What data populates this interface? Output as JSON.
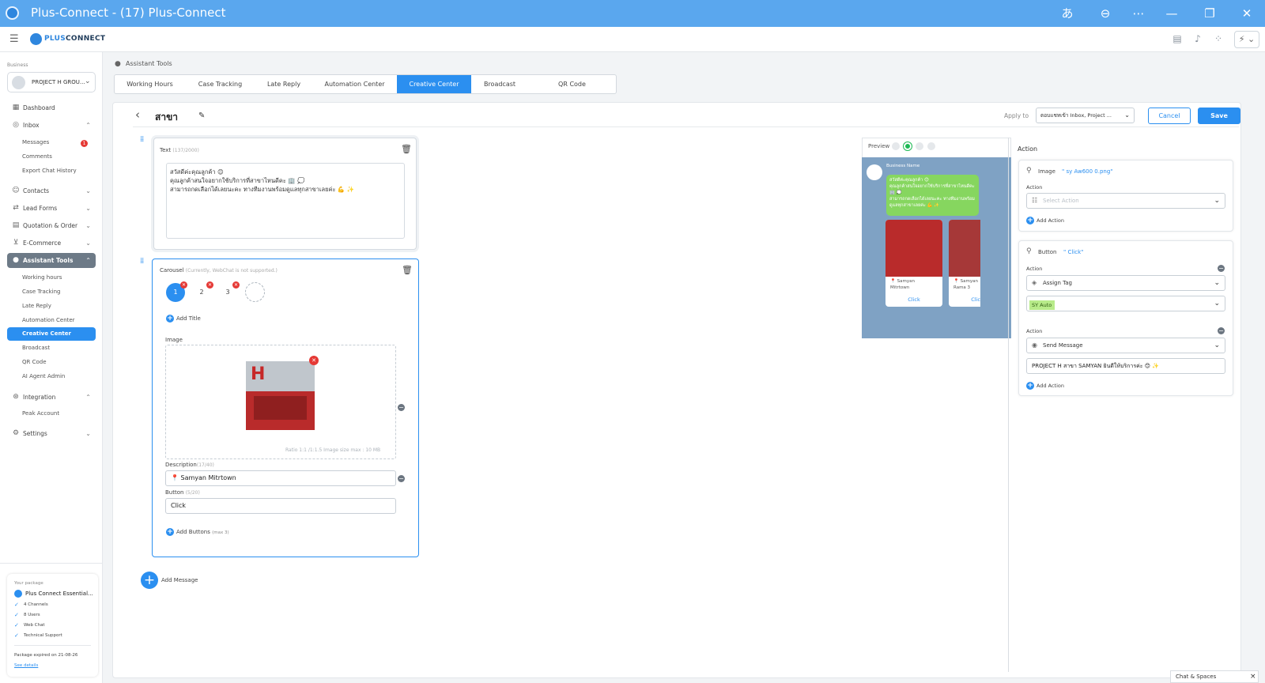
{
  "window": {
    "title": "Plus-Connect - (17) Plus-Connect"
  },
  "brand": {
    "left": "PLUS",
    "right": "CONNECT"
  },
  "sidebar": {
    "business_label": "Business",
    "business_name": "PROJECT H GROU...",
    "nav": {
      "dashboard": "Dashboard",
      "inbox": "Inbox",
      "messages": "Messages",
      "messages_badge": "1",
      "comments": "Comments",
      "export_chat_history": "Export Chat History",
      "contacts": "Contacts",
      "lead_forms": "Lead Forms",
      "quotation_order": "Quotation & Order",
      "ecommerce": "E-Commerce",
      "assistant_tools": "Assistant Tools",
      "working_hours": "Working hours",
      "case_tracking": "Case Tracking",
      "late_reply": "Late Reply",
      "automation_center": "Automation Center",
      "creative_center": "Creative Center",
      "broadcast": "Broadcast",
      "qr_code": "QR Code",
      "ai_agent_admin": "AI Agent Admin",
      "integration": "Integration",
      "peak_account": "Peak Account",
      "settings": "Settings"
    },
    "package": {
      "label": "Your package",
      "name": "Plus Connect Essential...",
      "features": [
        "4 Channels",
        "8 Users",
        "Web Chat",
        "Technical Support"
      ],
      "expiry": "Package expired on 21-08-26",
      "see_details": "See details"
    }
  },
  "breadcrumb": "Assistant Tools",
  "tabs": [
    {
      "label": "Working Hours",
      "active": false
    },
    {
      "label": "Case Tracking",
      "active": false
    },
    {
      "label": "Late Reply",
      "active": false
    },
    {
      "label": "Automation Center",
      "active": false
    },
    {
      "label": "Creative Center",
      "active": true
    },
    {
      "label": "Broadcast",
      "active": false
    },
    {
      "label": "QR Code",
      "active": false
    }
  ],
  "editor": {
    "title": "สาขา",
    "apply_to_label": "Apply to",
    "apply_to_value": "ตอบแชทเข้า Inbox, Project ...",
    "cancel": "Cancel",
    "save": "Save"
  },
  "text_block": {
    "label": "Text",
    "counter": "(137/2000)",
    "content": "สวัสดีค่ะคุณลูกค้า 😊\nคุณลูกค้าสนใจอยากใช้บริการที่สาขาไหนดีคะ 🏢 💭\nสามารถกดเลือกได้เลยนะคะ ทางทีมงานพร้อมดูแลทุกสาขาเลยค่ะ 💪 ✨"
  },
  "carousel_block": {
    "label": "Carousel",
    "note": "(Currently, WebChat is not supported.)",
    "pills": [
      "1",
      "2",
      "3"
    ],
    "add_title": "Add Title",
    "image_label": "Image",
    "image_hint": "Ratio 1:1 /1:1.5 Image size max : 10 MB",
    "description_label": "Description",
    "description_counter": "(17/40)",
    "description_value": "📍 Samyan Mitrtown",
    "button_label": "Button",
    "button_counter": "(5/20)",
    "button_value": "Click",
    "add_buttons": "Add Buttons",
    "add_buttons_max": "(max 3)"
  },
  "add_message": "Add Message",
  "preview": {
    "label": "Preview",
    "business_name": "Business Name",
    "bubble_text": "สวัสดีค่ะคุณลูกค้า 😊\nคุณลูกค้าสนใจอยากใช้บริการที่สาขาไหนดีคะ 🏢 💭\nสามารถกดเลือกได้เลยนะคะ ทางทีมงานพร้อมดูแลทุกสาขาเลยค่ะ 💪 ✨",
    "cards": [
      {
        "desc": "📍 Samyan\nMitrtown",
        "button": "Click"
      },
      {
        "desc": "📍 Samyan\nRama 3",
        "button": "Click"
      }
    ]
  },
  "action_panel": {
    "title": "Action",
    "image_card": {
      "type": "Image",
      "name": "\" sy Aw600 0.png\"",
      "action_label": "Action",
      "select_placeholder": "Select Action",
      "add_action": "Add Action"
    },
    "button_card": {
      "type": "Button",
      "name": "\" Click\"",
      "action_label": "Action",
      "action1": "Assign Tag",
      "tag": "SY Auto",
      "action2_label": "Action",
      "action2": "Send Message",
      "message": "PROJECT H สาขา SAMYAN ยินดีให้บริการค่ะ 😊 ✨",
      "add_action": "Add Action"
    }
  },
  "chat_spaces": {
    "label": "Chat & Spaces",
    "close": "×"
  },
  "colors": {
    "accent": "#2b8ff0",
    "titlebar": "#5aa7ee",
    "danger": "#e53935"
  }
}
